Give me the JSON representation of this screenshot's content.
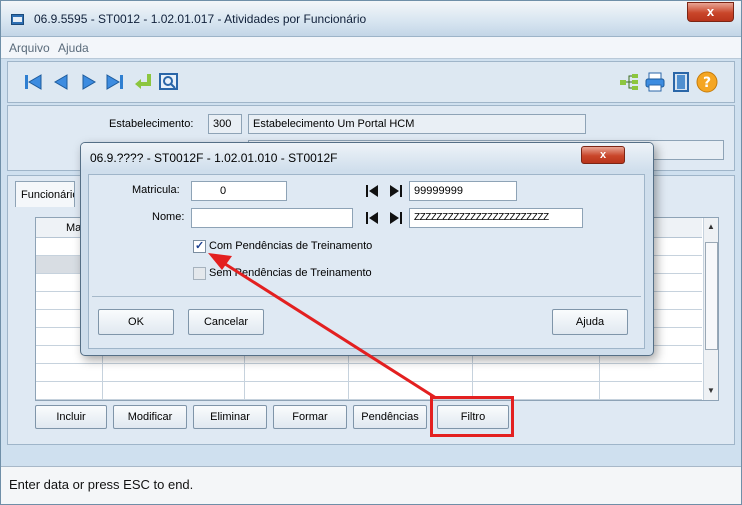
{
  "window": {
    "title": "06.9.5595 - ST0012 - 1.02.01.017 - Atividades por Funcionário",
    "close_glyph": "x"
  },
  "menu": {
    "items": [
      "Arquivo",
      "Ajuda"
    ]
  },
  "toolbar": {
    "left_icons": [
      "first-record-icon",
      "previous-record-icon",
      "next-record-icon",
      "last-record-icon",
      "goto-icon",
      "search-icon"
    ],
    "right_icons": [
      "tree-icon",
      "print-icon",
      "exit-door-icon",
      "help-icon"
    ]
  },
  "estabelecimento": {
    "label": "Estabelecimento:",
    "code": "300",
    "name": "Estabelecimento Um Portal HCM"
  },
  "tab": {
    "label": "Funcionários"
  },
  "grid": {
    "header_fragment": "Ma",
    "rows_visible": 9
  },
  "buttons": {
    "incluir": "Incluir",
    "modificar": "Modificar",
    "eliminar": "Eliminar",
    "formar": "Formar",
    "pendencias": "Pendências",
    "filtro": "Filtro"
  },
  "status": "Enter data or press ESC to end.",
  "dialog": {
    "title": "06.9.???? - ST0012F - 1.02.01.010 - ST0012F",
    "close_glyph": "x",
    "matricula_label": "Matricula:",
    "matricula_from": "0",
    "matricula_to": "99999999",
    "nome_label": "Nome:",
    "nome_from": "",
    "nome_to": "ZZZZZZZZZZZZZZZZZZZZZZZZ",
    "check_com": {
      "label": "Com Pendências de Treinamento",
      "checked": true
    },
    "check_sem": {
      "label": "Sem Pendências de Treinamento",
      "checked": false
    },
    "ok": "OK",
    "cancelar": "Cancelar",
    "ajuda": "Ajuda"
  },
  "colors": {
    "annotation_red": "#e32020",
    "window_bg": "#cfe0ef"
  }
}
